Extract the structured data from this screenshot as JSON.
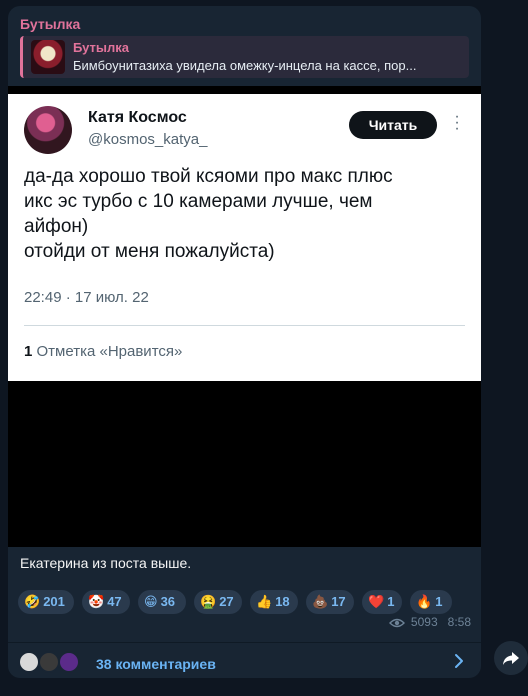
{
  "message": {
    "sender": "Бутылка",
    "reply": {
      "title": "Бутылка",
      "text": "Бимбоунитазиха увидела омежку-инцела на кассе, пор..."
    },
    "tweet": {
      "name": "Катя Космос",
      "handle": "@kosmos_katya_",
      "follow_label": "Читать",
      "text_lines": [
        "да-да хорошо твой ксяоми про макс плюс",
        "икс эс турбо с 10 камерами лучше, чем",
        "айфон)",
        "отойди от меня пожалуйста)"
      ],
      "timestamp": "22:49 · 17 июл. 22",
      "likes_count": "1",
      "likes_label": "Отметка «Нравится»"
    },
    "caption": "Екатерина из поста выше.",
    "reactions": [
      {
        "emoji": "🤣",
        "count": "201"
      },
      {
        "emoji": "🤡",
        "count": "47"
      },
      {
        "emoji": "😁",
        "count": "36"
      },
      {
        "emoji": "🤮",
        "count": "27"
      },
      {
        "emoji": "👍",
        "count": "18"
      },
      {
        "emoji": "💩",
        "count": "17"
      },
      {
        "emoji": "❤️",
        "count": "1"
      },
      {
        "emoji": "🔥",
        "count": "1"
      }
    ],
    "views": "5093",
    "time": "8:58",
    "comments_label": "38 комментариев"
  },
  "icons": {
    "eye": "eye-icon",
    "chevron": "chevron-right-icon",
    "share": "share-icon",
    "more": "more-vertical-icon"
  },
  "colors": {
    "sender": "#e1739b",
    "accent": "#6ab3f3",
    "bubble": "#182533"
  }
}
